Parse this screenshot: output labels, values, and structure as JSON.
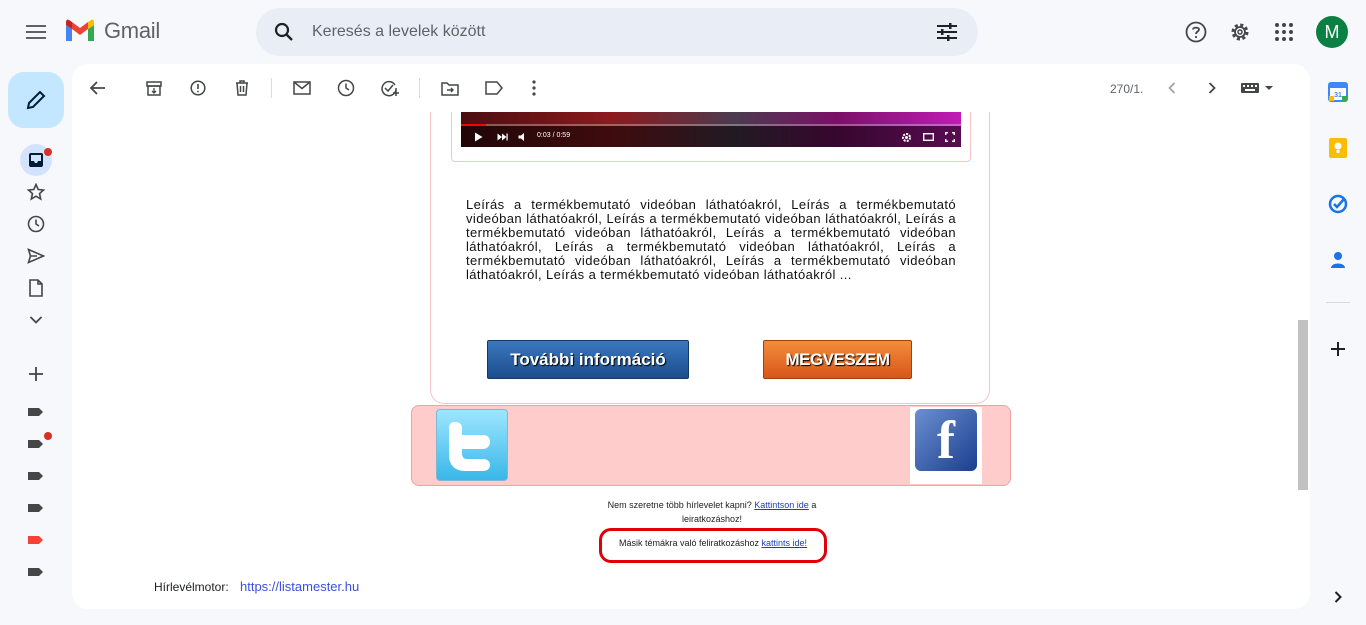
{
  "app": {
    "name": "Gmail",
    "avatar_letter": "M"
  },
  "search": {
    "placeholder": "Keresés a levelek között"
  },
  "toolbar": {
    "pager": "270/1."
  },
  "video": {
    "time": "0:03 / 0:59",
    "progress": 0.05
  },
  "email": {
    "description": "Leírás a termékbemutató videóban láthatóakról, Leírás a termékbemutató videóban láthatóakról, Leírás a termékbemutató videóban láthatóakról, Leírás a termékbemutató videóban láthatóakról, Leírás a termékbemutató videóban láthatóakról, Leírás a termékbemutató videóban láthatóakról, Leírás a termékbemutató videóban láthatóakról, Leírás a termékbemutató videóban láthatóakról, Leírás a termékbemutató videóban láthatóakról ...",
    "btn_info": "További információ",
    "btn_buy": "MEGVESZEM",
    "unsub_text_1": "Nem szeretne több hírlevelet kapni? ",
    "unsub_link": "Kattintson ide",
    "unsub_text_2": " a leiratkozáshoz!",
    "other_text": "Másik témákra való feliratkozáshoz ",
    "other_link": "kattints ide!",
    "engine_label": "Hírlevélmotor:",
    "engine_link": "https://listamester.hu"
  },
  "colors": {
    "compose_bg": "#c2e7ff",
    "social_bg": "#ffcccc",
    "highlight_border": "#e0000a"
  }
}
